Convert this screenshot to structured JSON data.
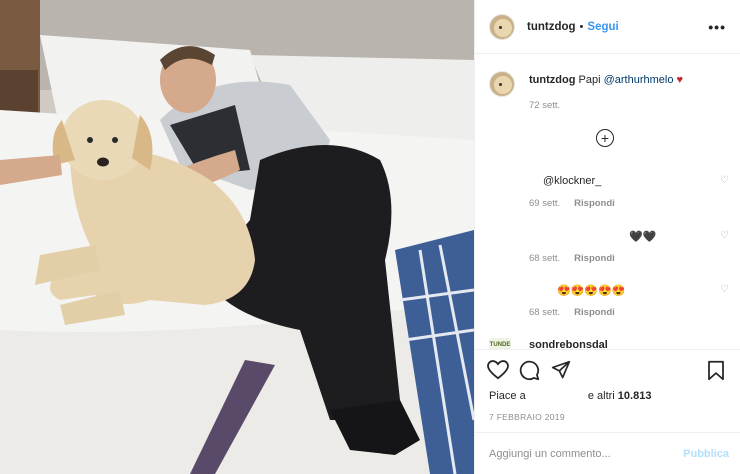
{
  "post": {
    "username": "tuntzdog",
    "dot": "•",
    "follow_label": "Segui",
    "more_label": "•••"
  },
  "caption": {
    "username": "tuntzdog",
    "text": "Papi",
    "mention": "@arthurhmelo",
    "heart": "♥",
    "time": "72 sett."
  },
  "load_more_symbol": "+",
  "comments": [
    {
      "text": "@klockner_",
      "time": "69 sett.",
      "reply": "Rispondi"
    },
    {
      "text": "🖤🖤",
      "time": "68 sett.",
      "reply": "Rispondi"
    },
    {
      "text": "😍😍😍😍😍",
      "time": "68 sett.",
      "reply": "Rispondi"
    }
  ],
  "last_comment": {
    "logo": "TUNDE",
    "username": "sondrebonsdal"
  },
  "likes": {
    "prefix": "Piace a",
    "suffix": "e altri",
    "count": "10.813"
  },
  "date": "7 FEBBRAIO 2019",
  "add_comment": {
    "placeholder": "Aggiungi un commento...",
    "publish_label": "Pubblica"
  },
  "colors": {
    "link_blue": "#3897f0",
    "publish_disabled": "#b2dffc",
    "muted": "#8e8e8e"
  }
}
